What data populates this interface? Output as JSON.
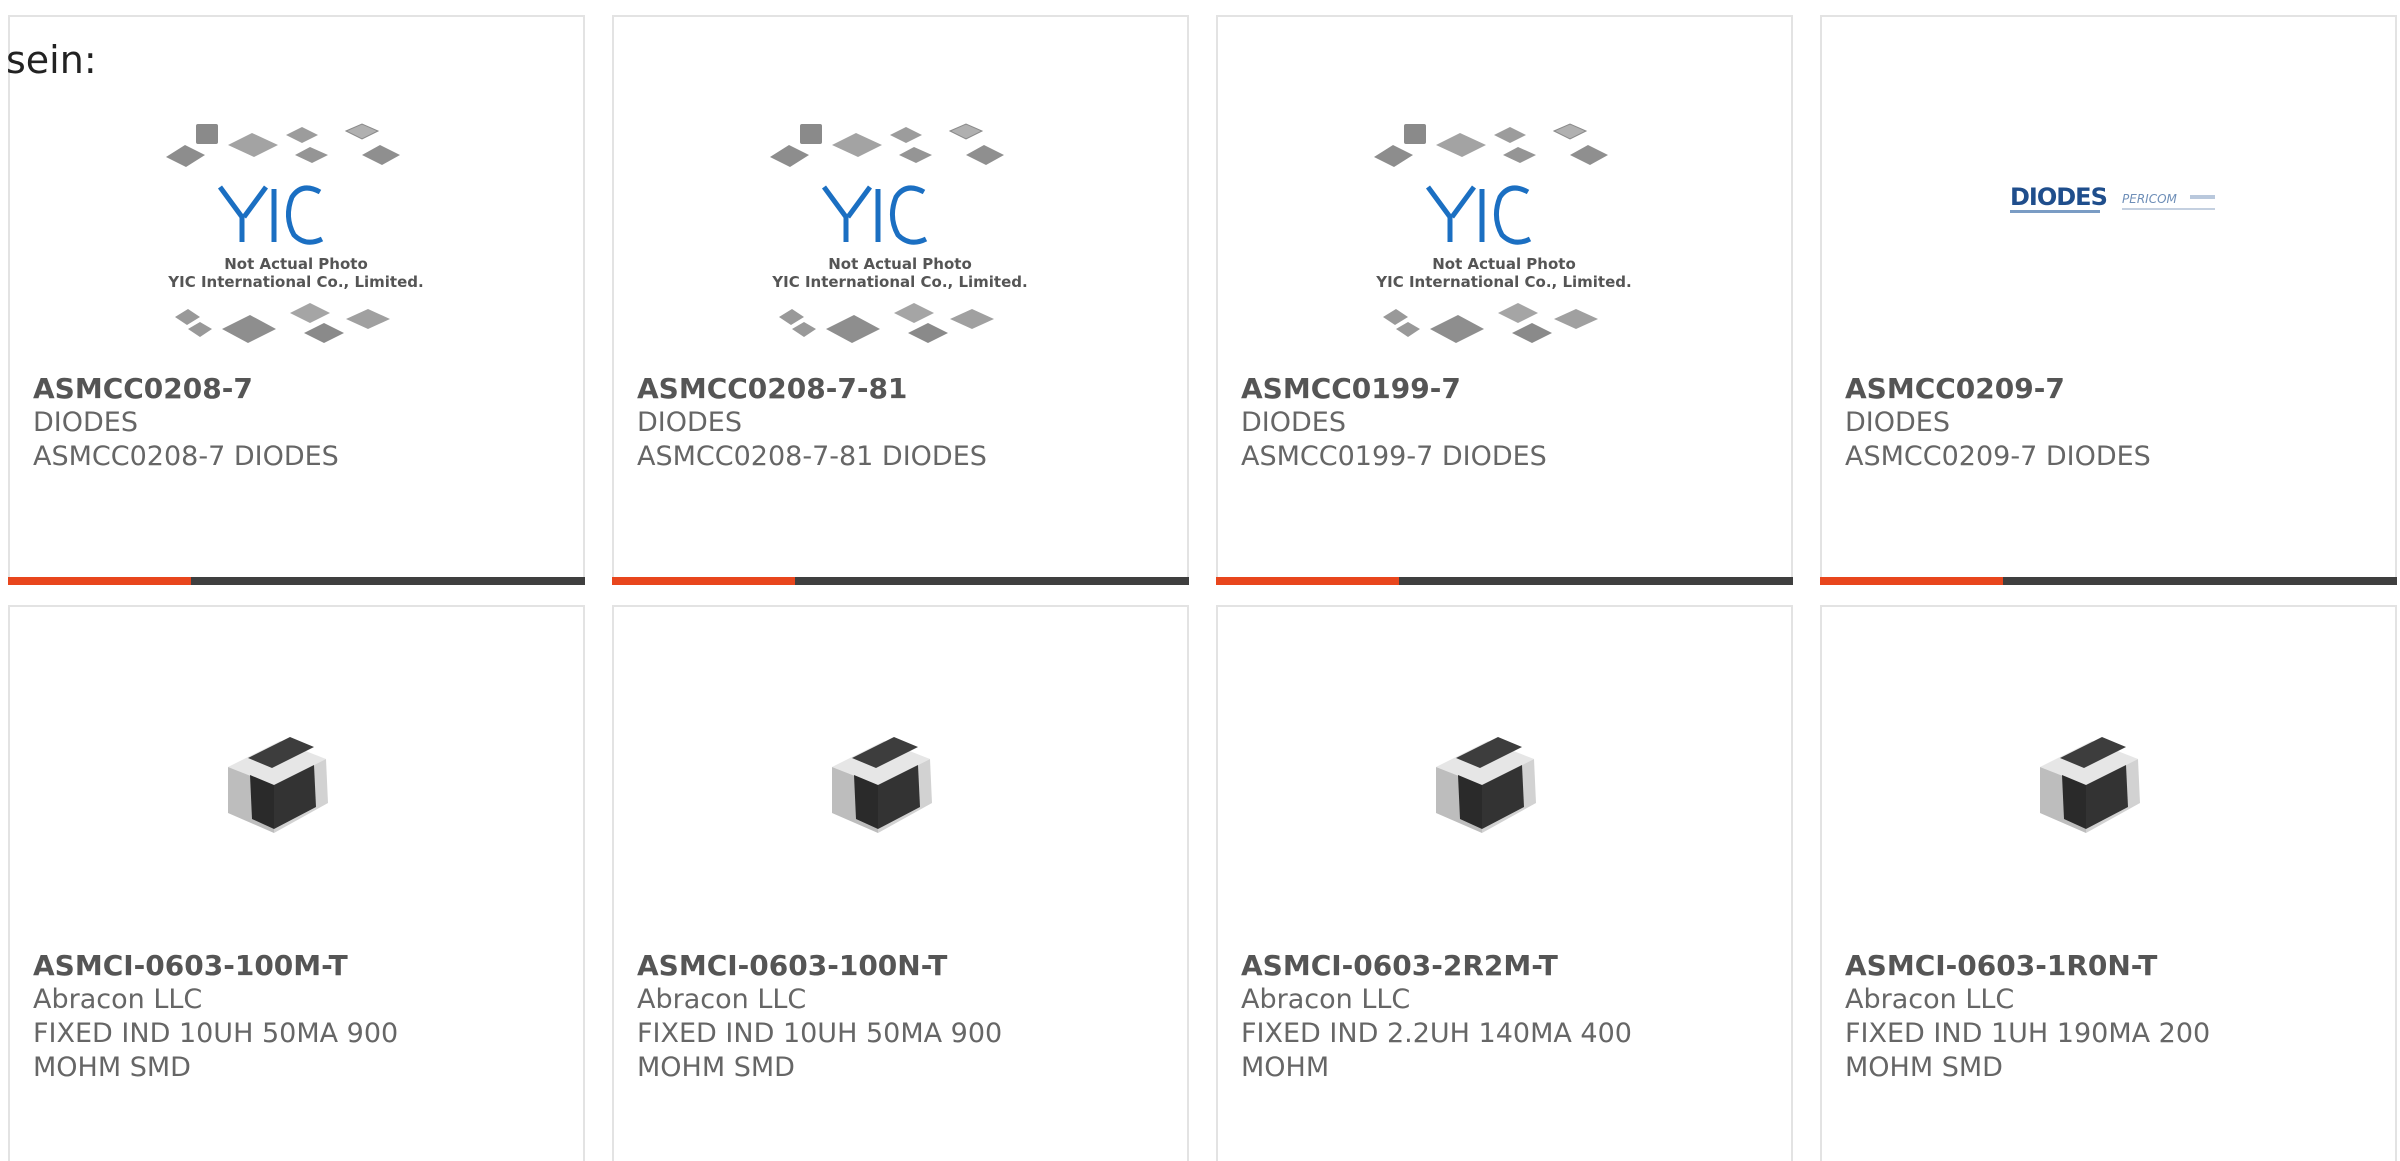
{
  "intro_text": "sein:",
  "products": [
    {
      "part_no": "ASMCC0208-7",
      "manufacturer": "DIODES",
      "description": "ASMCC0208-7 DIODES",
      "image_type": "yic-placeholder",
      "image_caption_1": "Not Actual Photo",
      "image_caption_2": "YIC International Co., Limited."
    },
    {
      "part_no": "ASMCC0208-7-81",
      "manufacturer": "DIODES",
      "description": "ASMCC0208-7-81 DIODES",
      "image_type": "yic-placeholder",
      "image_caption_1": "Not Actual Photo",
      "image_caption_2": "YIC International Co., Limited."
    },
    {
      "part_no": "ASMCC0199-7",
      "manufacturer": "DIODES",
      "description": "ASMCC0199-7 DIODES",
      "image_type": "yic-placeholder",
      "image_caption_1": "Not Actual Photo",
      "image_caption_2": "YIC International Co., Limited."
    },
    {
      "part_no": "ASMCC0209-7",
      "manufacturer": "DIODES",
      "description": "ASMCC0209-7 DIODES",
      "image_type": "diodes-logo",
      "logo_text_1": "DIODES",
      "logo_text_2": "PERICOM"
    },
    {
      "part_no": "ASMCI-0603-100M-T",
      "manufacturer": "Abracon LLC",
      "description_line1": "FIXED IND 10UH 50MA 900",
      "description_line2": "MOHM SMD",
      "image_type": "smd-inductor"
    },
    {
      "part_no": "ASMCI-0603-100N-T",
      "manufacturer": "Abracon LLC",
      "description_line1": "FIXED IND 10UH 50MA 900",
      "description_line2": "MOHM SMD",
      "image_type": "smd-inductor"
    },
    {
      "part_no": "ASMCI-0603-2R2M-T",
      "manufacturer": "Abracon LLC",
      "description_line1": "FIXED IND 2.2UH 140MA 400",
      "description_line2": "MOHM",
      "image_type": "smd-inductor"
    },
    {
      "part_no": "ASMCI-0603-1R0N-T",
      "manufacturer": "Abracon LLC",
      "description_line1": "FIXED IND 1UH 190MA 200",
      "description_line2": "MOHM SMD",
      "image_type": "smd-inductor"
    }
  ],
  "colors": {
    "accent": "#e8461d",
    "bar_dark": "#3f3f3f",
    "yic_blue": "#1b6fc2",
    "diodes_blue": "#1f4e8c"
  }
}
